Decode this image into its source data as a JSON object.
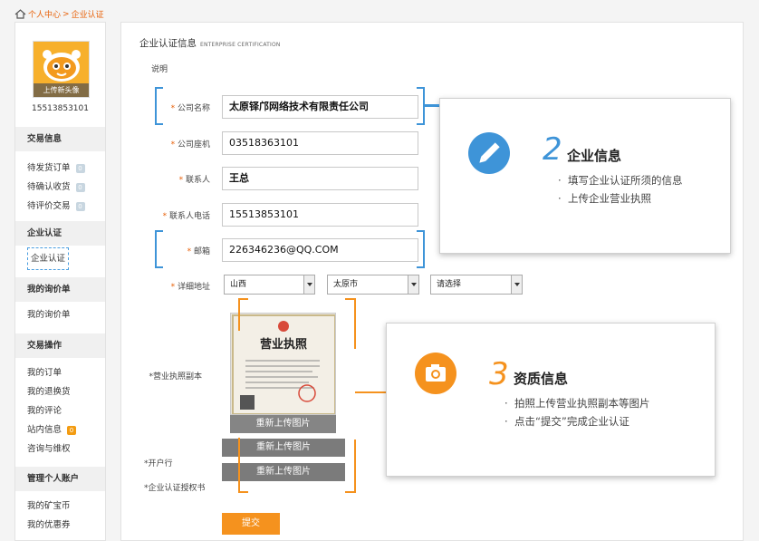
{
  "breadcrumb": {
    "items": [
      "个人中心",
      "企业认证"
    ],
    "separator": ">"
  },
  "sidebar": {
    "avatar_upload": "上传新头像",
    "phone": "15513853101",
    "groups": [
      {
        "title": "交易信息",
        "items": [
          {
            "label": "待发货订单",
            "badge": "0"
          },
          {
            "label": "待确认收货",
            "badge": "0"
          },
          {
            "label": "待评价交易",
            "badge": "0"
          }
        ]
      },
      {
        "title": "企业认证",
        "items": [
          {
            "label": "企业认证",
            "badge": ""
          }
        ]
      },
      {
        "title": "我的询价单",
        "items": [
          {
            "label": "我的询价单",
            "badge": ""
          }
        ]
      },
      {
        "title": "交易操作",
        "items": [
          {
            "label": "我的订单",
            "badge": ""
          },
          {
            "label": "我的退换货",
            "badge": ""
          },
          {
            "label": "我的评论",
            "badge": ""
          },
          {
            "label": "站内信息",
            "badge": "0"
          },
          {
            "label": "咨询与维权",
            "badge": ""
          }
        ]
      },
      {
        "title": "管理个人账户",
        "items": [
          {
            "label": "我的矿宝币",
            "badge": ""
          },
          {
            "label": "我的优惠券",
            "badge": ""
          }
        ]
      }
    ]
  },
  "main": {
    "title": "企业认证信息",
    "title_en": "ENTERPRISE CERTIFICATION",
    "note": "说明",
    "fields": {
      "company_name": {
        "label": "公司名称",
        "value": "太原铎邝网络技术有限责任公司"
      },
      "company_phone": {
        "label": "公司座机",
        "value": "03518363101"
      },
      "contact": {
        "label": "联系人",
        "value": "王总"
      },
      "contact_phone": {
        "label": "联系人电话",
        "value": "15513853101"
      },
      "email": {
        "label": "邮箱",
        "value": "226346236@QQ.COM"
      }
    },
    "address": {
      "label": "详细地址",
      "province": "山西",
      "city": "太原市",
      "district": "请选择"
    },
    "license_label": "*营业执照副本",
    "license_image_title": "营业执照",
    "bank_label": "*开户行",
    "auth_label": "*企业认证授权书",
    "reupload_label": "重新上传图片",
    "submit_label": "提交"
  },
  "callouts": {
    "info": {
      "number": "2",
      "title": "企业信息",
      "bullets": [
        "填写企业认证所须的信息",
        "上传企业营业执照"
      ]
    },
    "qual": {
      "number": "3",
      "title": "资质信息",
      "bullets": [
        "拍照上传营业执照副本等图片",
        "点击“提交”完成企业认证"
      ]
    }
  },
  "colors": {
    "accent": "#f5921e",
    "blue": "#3e94d8"
  },
  "icons": {
    "home": "home-icon",
    "pencil": "pencil-icon",
    "camera": "camera-icon"
  }
}
